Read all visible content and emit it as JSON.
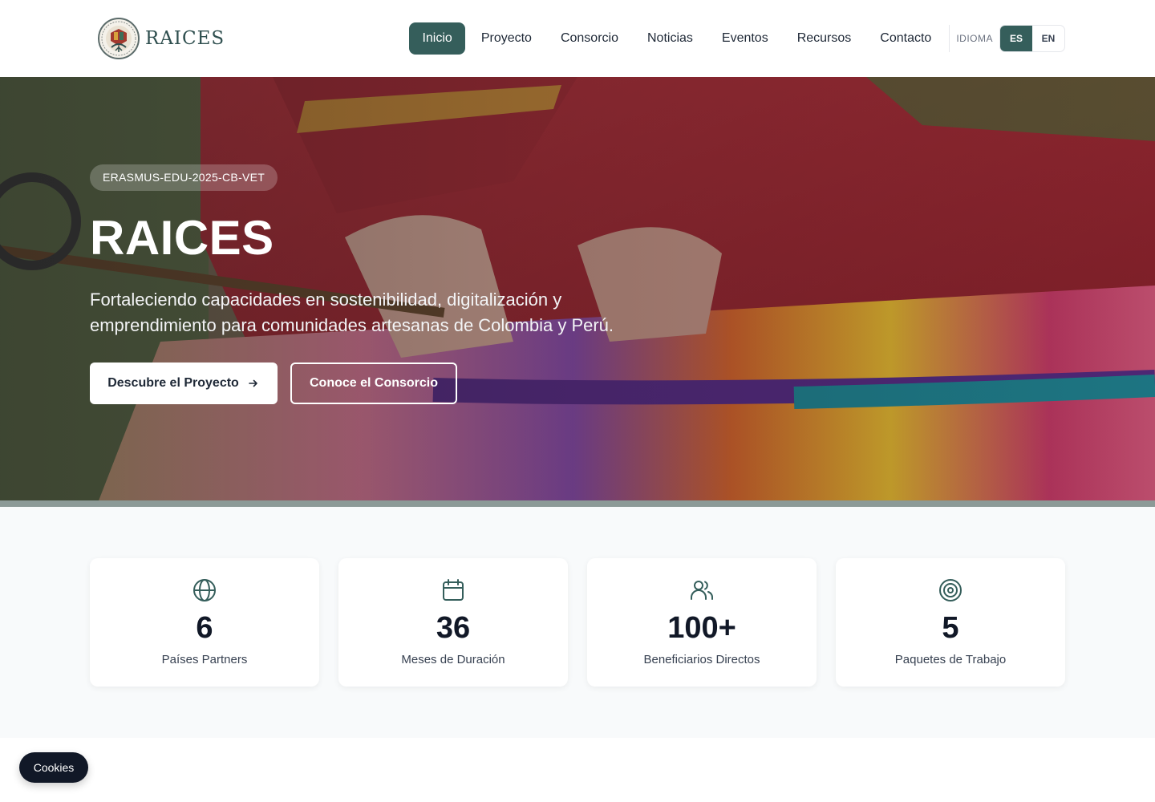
{
  "header": {
    "brand": "RAICES",
    "nav": [
      {
        "label": "Inicio",
        "active": true
      },
      {
        "label": "Proyecto",
        "active": false
      },
      {
        "label": "Consorcio",
        "active": false
      },
      {
        "label": "Noticias",
        "active": false
      },
      {
        "label": "Eventos",
        "active": false
      },
      {
        "label": "Recursos",
        "active": false
      },
      {
        "label": "Contacto",
        "active": false
      }
    ],
    "language": {
      "label": "IDIOMA",
      "options": [
        "ES",
        "EN"
      ],
      "selected": "ES"
    }
  },
  "hero": {
    "badge": "ERASMUS-EDU-2025-CB-VET",
    "title": "RAICES",
    "subtitle": "Fortaleciendo capacidades en sostenibilidad, digitalización y emprendimiento para comunidades artesanas de Colombia y Perú.",
    "primary_button": "Descubre el Proyecto",
    "secondary_button": "Conoce el Consorcio"
  },
  "stats": [
    {
      "icon": "globe-icon",
      "value": "6",
      "label": "Países Partners"
    },
    {
      "icon": "calendar-icon",
      "value": "36",
      "label": "Meses de Duración"
    },
    {
      "icon": "users-icon",
      "value": "100+",
      "label": "Beneficiarios Directos"
    },
    {
      "icon": "target-icon",
      "value": "5",
      "label": "Paquetes de Trabajo"
    }
  ],
  "cookies": {
    "label": "Cookies"
  },
  "colors": {
    "accent": "#355e5b",
    "dark": "#111827",
    "stats_bg": "#f8fafb"
  }
}
